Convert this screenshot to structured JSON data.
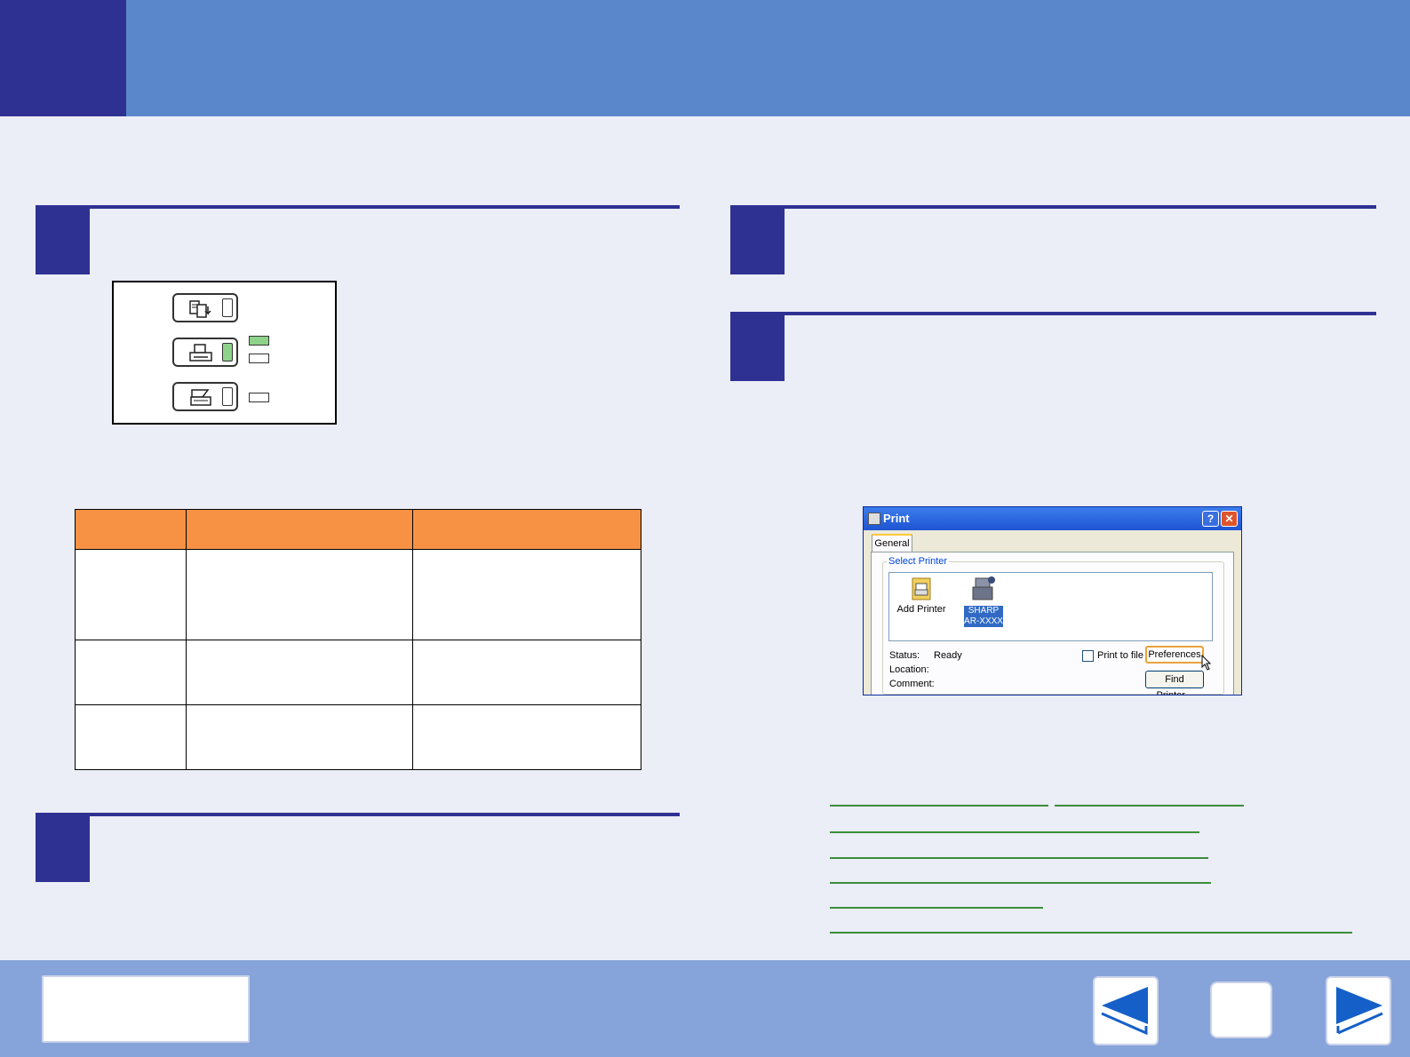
{
  "dialog": {
    "title": "Print",
    "help_label": "?",
    "close_label": "✕",
    "tab_general": "General",
    "group_select_printer": "Select Printer",
    "printers": [
      {
        "label": "Add Printer",
        "icon": "add-printer-icon"
      },
      {
        "label": "SHARP\nAR-XXXX",
        "icon": "printer-icon",
        "selected": true
      }
    ],
    "status_label": "Status:",
    "status_value": "Ready",
    "location_label": "Location:",
    "comment_label": "Comment:",
    "print_to_file_label": "Print to file",
    "preferences_label": "Preferences",
    "find_printer_label": "Find Printer..."
  },
  "colors": {
    "header": "#5a87cc",
    "accent": "#2e3192",
    "table_header": "#f79245",
    "lamp_on": "#8fd38a",
    "link": "#3b8e3b",
    "footer": "#87a4da"
  }
}
